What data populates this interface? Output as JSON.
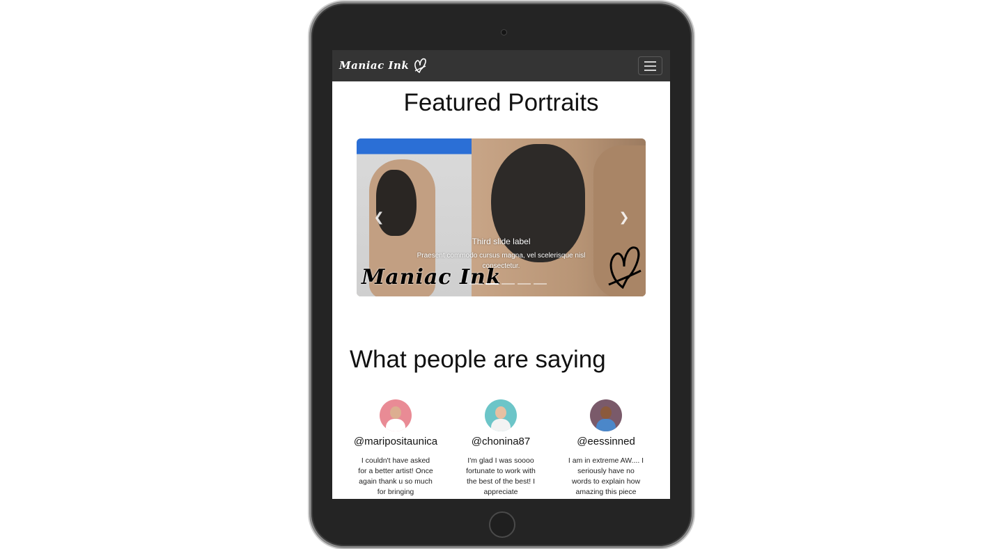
{
  "brand": {
    "name": "Maniac Ink"
  },
  "featured": {
    "title": "Featured Portraits",
    "carousel": {
      "caption_title": "Third slide label",
      "caption_text": "Praesent commodo cursus magna, vel scelerisque nisl consectetur.",
      "watermark": "Maniac Ink",
      "active_index": 1,
      "indicator_count": 5
    }
  },
  "testimonials": {
    "title": "What people are saying",
    "items": [
      {
        "handle": "@maripositaunica",
        "quote": "I couldn't have asked for a better artist! Once again thank u so much for bringing",
        "avatar_color": "#e98b95",
        "shirt_color": "#ffffff",
        "skin_color": "#dcae90"
      },
      {
        "handle": "@chonina87",
        "quote": "I'm glad I was soooo fortunate to work with the best of the best! I appreciate",
        "avatar_color": "#6cc5c8",
        "shirt_color": "#f3f3f3",
        "skin_color": "#e6c0a2"
      },
      {
        "handle": "@eessinned",
        "quote": "I am in extreme AW.... I seriously have no words to explain how amazing this piece",
        "avatar_color": "#7a5a6a",
        "shirt_color": "#4b87c9",
        "skin_color": "#8b5a3c"
      }
    ]
  },
  "colors": {
    "navbar": "#343434",
    "device": "#242424"
  }
}
